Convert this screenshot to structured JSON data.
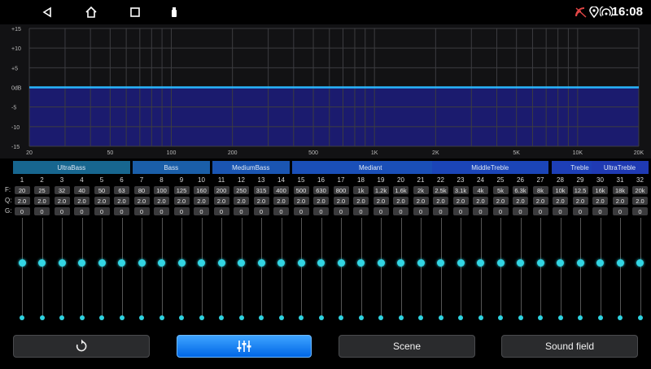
{
  "status": {
    "time": "16:08",
    "nav": [
      {
        "icon": "back-icon",
        "glyph": "◁"
      },
      {
        "icon": "home-icon",
        "glyph": "⌂"
      },
      {
        "icon": "recent-apps-icon",
        "glyph": "□"
      },
      {
        "icon": "usb-icon",
        "glyph": "▮"
      }
    ]
  },
  "graph": {
    "db_labels": [
      "+15",
      "+10",
      "+5",
      "0dB",
      "-5",
      "-10",
      "-15"
    ],
    "db_values": [
      15,
      10,
      5,
      0,
      -5,
      -10,
      -15
    ],
    "freq_labels": [
      "20",
      "50",
      "100",
      "200",
      "500",
      "1K",
      "2K",
      "5K",
      "10K",
      "20K"
    ],
    "freq_values": [
      20,
      50,
      100,
      200,
      500,
      1000,
      2000,
      5000,
      10000,
      20000
    ],
    "curve_db": 0,
    "colors": {
      "curve": "#29b6ff",
      "fill": "#1b1b6e",
      "grid": "#3c3c40"
    }
  },
  "bands": [
    {
      "label": "UltraBass",
      "start": 1,
      "end": 6,
      "color": "#17668f"
    },
    {
      "label": "Bass",
      "start": 7,
      "end": 10,
      "color": "#1a5ea8"
    },
    {
      "label": "MediumBass",
      "start": 11,
      "end": 14,
      "color": "#1a55b2"
    },
    {
      "label": "Mediant",
      "start": 15,
      "end": 22,
      "color": "#1a4fb8"
    },
    {
      "label": "MiddleTreble",
      "start": 22,
      "end": 27,
      "color": "#1b45b8"
    },
    {
      "label": "Treble",
      "start": 28,
      "end": 30,
      "color": "#1d3fb7"
    },
    {
      "label": "UltraTreble",
      "start": 30,
      "end": 32,
      "color": "#1f3ab3"
    }
  ],
  "row_labels": {
    "f": "F:",
    "q": "Q:",
    "g": "G:"
  },
  "channels": [
    {
      "n": "1",
      "f": "20",
      "q": "2.0",
      "g": "0"
    },
    {
      "n": "2",
      "f": "25",
      "q": "2.0",
      "g": "0"
    },
    {
      "n": "3",
      "f": "32",
      "q": "2.0",
      "g": "0"
    },
    {
      "n": "4",
      "f": "40",
      "q": "2.0",
      "g": "0"
    },
    {
      "n": "5",
      "f": "50",
      "q": "2.0",
      "g": "0"
    },
    {
      "n": "6",
      "f": "63",
      "q": "2.0",
      "g": "0"
    },
    {
      "n": "7",
      "f": "80",
      "q": "2.0",
      "g": "0"
    },
    {
      "n": "8",
      "f": "100",
      "q": "2.0",
      "g": "0"
    },
    {
      "n": "9",
      "f": "125",
      "q": "2.0",
      "g": "0"
    },
    {
      "n": "10",
      "f": "160",
      "q": "2.0",
      "g": "0"
    },
    {
      "n": "11",
      "f": "200",
      "q": "2.0",
      "g": "0"
    },
    {
      "n": "12",
      "f": "250",
      "q": "2.0",
      "g": "0"
    },
    {
      "n": "13",
      "f": "315",
      "q": "2.0",
      "g": "0"
    },
    {
      "n": "14",
      "f": "400",
      "q": "2.0",
      "g": "0"
    },
    {
      "n": "15",
      "f": "500",
      "q": "2.0",
      "g": "0"
    },
    {
      "n": "16",
      "f": "630",
      "q": "2.0",
      "g": "0"
    },
    {
      "n": "17",
      "f": "800",
      "q": "2.0",
      "g": "0"
    },
    {
      "n": "18",
      "f": "1k",
      "q": "2.0",
      "g": "0"
    },
    {
      "n": "19",
      "f": "1.2k",
      "q": "2.0",
      "g": "0"
    },
    {
      "n": "20",
      "f": "1.6k",
      "q": "2.0",
      "g": "0"
    },
    {
      "n": "21",
      "f": "2k",
      "q": "2.0",
      "g": "0"
    },
    {
      "n": "22",
      "f": "2.5k",
      "q": "2.0",
      "g": "0"
    },
    {
      "n": "23",
      "f": "3.1k",
      "q": "2.0",
      "g": "0"
    },
    {
      "n": "24",
      "f": "4k",
      "q": "2.0",
      "g": "0"
    },
    {
      "n": "25",
      "f": "5k",
      "q": "2.0",
      "g": "0"
    },
    {
      "n": "26",
      "f": "6.3k",
      "q": "2.0",
      "g": "0"
    },
    {
      "n": "27",
      "f": "8k",
      "q": "2.0",
      "g": "0"
    },
    {
      "n": "28",
      "f": "10k",
      "q": "2.0",
      "g": "0"
    },
    {
      "n": "29",
      "f": "12.5",
      "q": "2.0",
      "g": "0"
    },
    {
      "n": "30",
      "f": "16k",
      "q": "2.0",
      "g": "0"
    },
    {
      "n": "31",
      "f": "18k",
      "q": "2.0",
      "g": "0"
    },
    {
      "n": "32",
      "f": "20k",
      "q": "2.0",
      "g": "0"
    }
  ],
  "gain_range": [
    -15,
    15
  ],
  "buttons": {
    "reset_icon": "reset-icon",
    "eq_icon": "eq-sliders-icon",
    "scene": "Scene",
    "sound_field": "Sound field"
  },
  "colors": {
    "accent": "#33d6e4",
    "button_active": "#0a7cff"
  }
}
